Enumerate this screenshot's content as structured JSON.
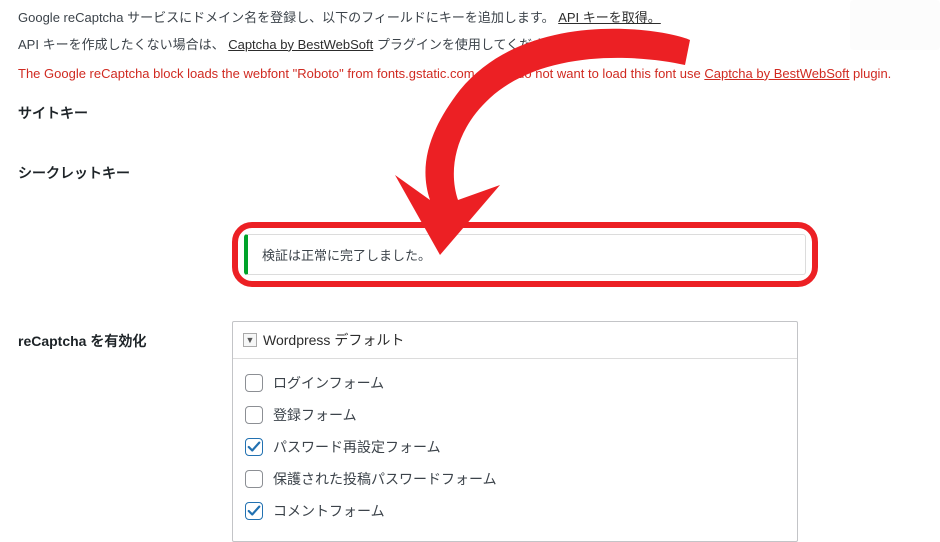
{
  "intro": {
    "line1_pre": "Google reCaptcha サービスにドメイン名を登録し、以下のフィールドにキーを追加します。",
    "line1_link": "API キーを取得。",
    "line2_pre": "API キーを作成したくない場合は、",
    "line2_link": "Captcha by BestWebSoft",
    "line2_post": " プラグインを使用してください。"
  },
  "warning": {
    "pre": "The Google reCaptcha block loads the webfont \"Roboto\" from fonts.gstatic.com. If you do not want to load this font use ",
    "link": "Captcha by BestWebSoft",
    "post": " plugin."
  },
  "fields": {
    "site_key_label": "サイトキー",
    "secret_key_label": "シークレットキー"
  },
  "status": {
    "message": "検証は正常に完了しました。"
  },
  "enable_section": {
    "label": "reCaptcha を有効化",
    "panel_title": "Wordpress デフォルト",
    "collapse_glyph": "▼",
    "items": [
      {
        "label": "ログインフォーム",
        "checked": false
      },
      {
        "label": "登録フォーム",
        "checked": false
      },
      {
        "label": "パスワード再設定フォーム",
        "checked": true
      },
      {
        "label": "保護された投稿パスワードフォーム",
        "checked": false
      },
      {
        "label": "コメントフォーム",
        "checked": true
      }
    ]
  }
}
